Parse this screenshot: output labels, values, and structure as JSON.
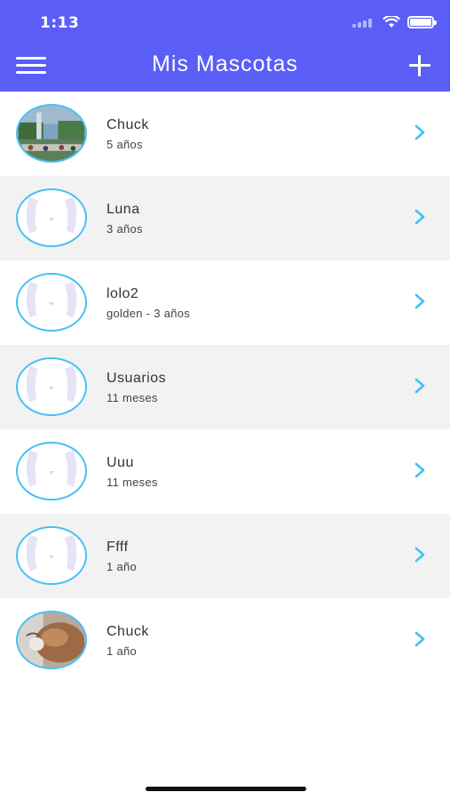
{
  "status_bar": {
    "time": "1:13"
  },
  "nav": {
    "title": "Mis Mascotas",
    "menu_icon": "hamburger-icon",
    "add_icon": "plus-icon"
  },
  "colors": {
    "header": "#5a5ef7",
    "accent": "#43c0f5",
    "alt_row": "#f2f2f2"
  },
  "pets": [
    {
      "name": "Chuck",
      "info": "5 años",
      "photo": "landscape"
    },
    {
      "name": "Luna",
      "info": "3 años",
      "photo": "placeholder"
    },
    {
      "name": "lolo2",
      "info": "golden - 3 años",
      "photo": "placeholder"
    },
    {
      "name": "Usuarios",
      "info": "11 meses",
      "photo": "placeholder"
    },
    {
      "name": "Uuu",
      "info": "11 meses",
      "photo": "placeholder"
    },
    {
      "name": "Ffff",
      "info": "1 año",
      "photo": "placeholder"
    },
    {
      "name": "Chuck",
      "info": "1 año",
      "photo": "dog"
    }
  ]
}
